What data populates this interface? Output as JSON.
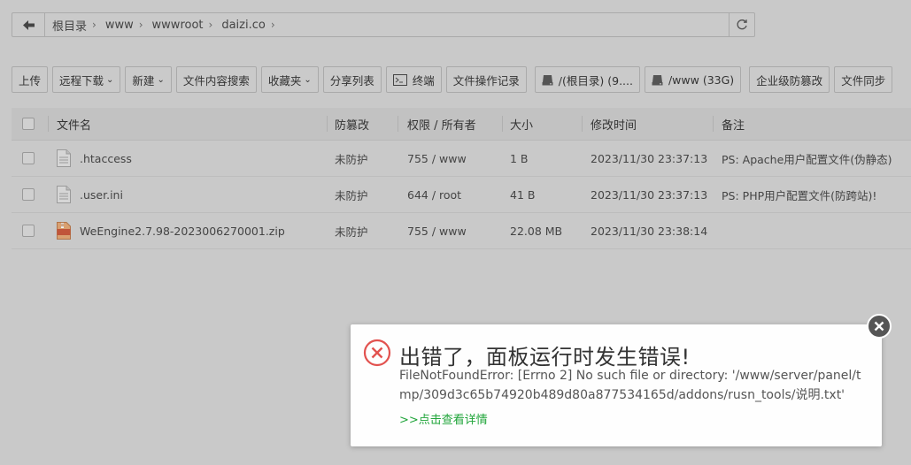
{
  "breadcrumb": {
    "items": [
      "根目录",
      "www",
      "wwwroot",
      "daizi.co"
    ],
    "separator": "›"
  },
  "toolbar": {
    "upload": "上传",
    "remote_download": "远程下载",
    "new": "新建",
    "content_search": "文件内容搜索",
    "favorites": "收藏夹",
    "share_list": "分享列表",
    "terminal": "终端",
    "operation_log": "文件操作记录",
    "disk_root": "/(根目录) (9....",
    "disk_www": "/www (33G)",
    "enterprise_tamper": "企业级防篡改",
    "file_sync": "文件同步"
  },
  "table": {
    "headers": {
      "name": "文件名",
      "tamper": "防篡改",
      "perm": "权限 / 所有者",
      "size": "大小",
      "mtime": "修改时间",
      "note": "备注"
    },
    "rows": [
      {
        "name": ".htaccess",
        "tamper": "未防护",
        "perm": "755 / www",
        "size": "1 B",
        "mtime": "2023/11/30 23:37:13",
        "note": "PS: Apache用户配置文件(伪静态)"
      },
      {
        "name": ".user.ini",
        "tamper": "未防护",
        "perm": "644 / root",
        "size": "41 B",
        "mtime": "2023/11/30 23:37:13",
        "note": "PS: PHP用户配置文件(防跨站)!"
      },
      {
        "name": "WeEngine2.7.98-2023006270001.zip",
        "tamper": "未防护",
        "perm": "755 / www",
        "size": "22.08 MB",
        "mtime": "2023/11/30 23:38:14",
        "note": ""
      }
    ]
  },
  "dialog": {
    "title": "出错了，面板运行时发生错误!",
    "message": "FileNotFoundError: [Errno 2] No such file or directory: '/www/server/panel/tmp/309d3c65b74920b489d80a877534165d/addons/rusn_tools/说明.txt'",
    "link": ">>点击查看详情"
  },
  "colors": {
    "accent_green": "#20a53a",
    "error_red": "#e2524f"
  }
}
